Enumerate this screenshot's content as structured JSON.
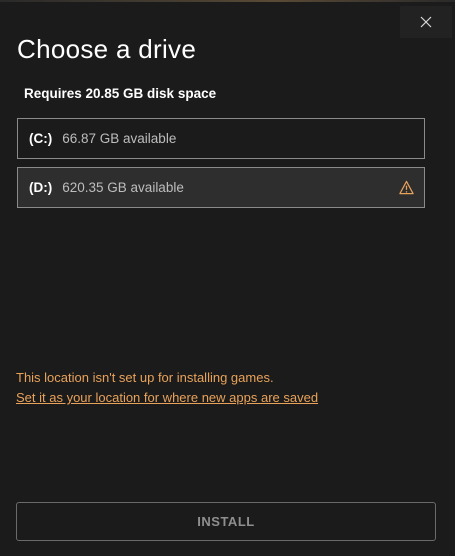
{
  "dialog": {
    "title": "Choose a drive",
    "requirement": "Requires 20.85 GB disk space",
    "close_icon": "close-icon"
  },
  "drives": [
    {
      "letter": "(C:)",
      "space": "66.87 GB available",
      "selected": false,
      "warning": false
    },
    {
      "letter": "(D:)",
      "space": "620.35 GB available",
      "selected": true,
      "warning": true,
      "warning_icon": "warning-icon"
    }
  ],
  "message": {
    "text": "This location isn't set up for installing games.",
    "link": "Set it as your location for where new apps are saved"
  },
  "install": {
    "label": "INSTALL",
    "enabled": false
  },
  "colors": {
    "background": "#1b1b1b",
    "warning": "#e8a25a",
    "border": "#8a8a8a",
    "selected_bg": "#2e2e2e"
  }
}
